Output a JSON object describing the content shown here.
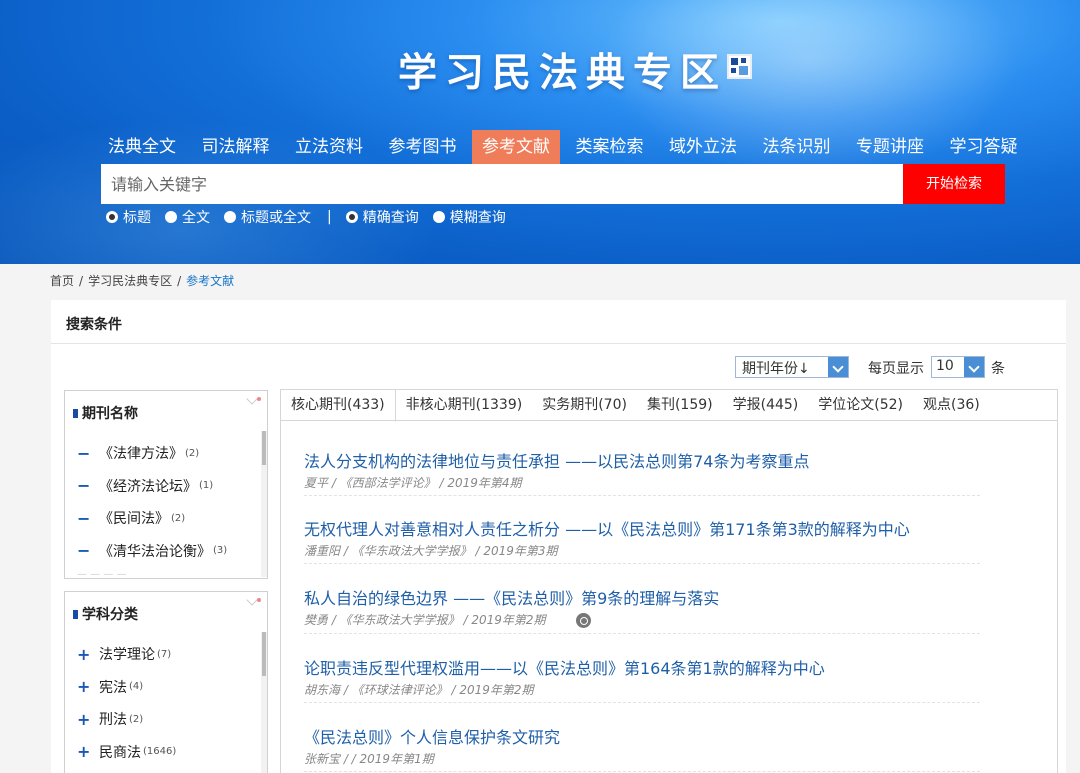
{
  "header": {
    "title": "学习民法典专区",
    "nav": [
      {
        "label": "法典全文",
        "active": false
      },
      {
        "label": "司法解释",
        "active": false
      },
      {
        "label": "立法资料",
        "active": false
      },
      {
        "label": "参考图书",
        "active": false
      },
      {
        "label": "参考文献",
        "active": true
      },
      {
        "label": "类案检索",
        "active": false
      },
      {
        "label": "域外立法",
        "active": false
      },
      {
        "label": "法条识别",
        "active": false
      },
      {
        "label": "专题讲座",
        "active": false
      },
      {
        "label": "学习答疑",
        "active": false
      }
    ],
    "search_placeholder": "请输入关键字",
    "search_button": "开始检索",
    "scope_options": [
      {
        "label": "标题",
        "selected": true
      },
      {
        "label": "全文",
        "selected": false
      },
      {
        "label": "标题或全文",
        "selected": false
      }
    ],
    "separator": "|",
    "match_options": [
      {
        "label": "精确查询",
        "selected": true
      },
      {
        "label": "模糊查询",
        "selected": false
      }
    ]
  },
  "breadcrumb": {
    "items": [
      "首页",
      "学习民法典专区",
      "参考文献"
    ],
    "separator": "/"
  },
  "filters": {
    "title": "搜索条件",
    "sort_select": "期刊年份↓",
    "per_page_label": "每页显示",
    "per_page_value": "10",
    "per_page_unit": "条"
  },
  "journal_panel": {
    "title": "期刊名称",
    "items": [
      {
        "label": "《法律方法》",
        "count": "(2)"
      },
      {
        "label": "《经济法论坛》",
        "count": "(1)"
      },
      {
        "label": "《民间法》",
        "count": "(2)"
      },
      {
        "label": "《清华法治论衡》",
        "count": "(3)"
      }
    ]
  },
  "subject_panel": {
    "title": "学科分类",
    "items": [
      {
        "label": "法学理论",
        "count": "(7)"
      },
      {
        "label": "宪法",
        "count": "(4)"
      },
      {
        "label": "刑法",
        "count": "(2)"
      },
      {
        "label": "民商法",
        "count": "(1646)"
      }
    ]
  },
  "tabs": [
    {
      "label": "核心期刊(433)",
      "active": true
    },
    {
      "label": "非核心期刊(1339)",
      "active": false
    },
    {
      "label": "实务期刊(70)",
      "active": false
    },
    {
      "label": "集刊(159)",
      "active": false
    },
    {
      "label": "学报(445)",
      "active": false
    },
    {
      "label": "学位论文(52)",
      "active": false
    },
    {
      "label": "观点(36)",
      "active": false
    }
  ],
  "articles": [
    {
      "title": "法人分支机构的法律地位与责任承担 ——以民法总则第74条为考察重点",
      "meta": "夏平 / 《西部法学评论》 / 2019年第4期"
    },
    {
      "title": "无权代理人对善意相对人责任之析分 ——以《民法总则》第171条第3款的解释为中心",
      "meta": "潘重阳 / 《华东政法大学学报》 / 2019年第3期"
    },
    {
      "title": "私人自治的绿色边界 ——《民法总则》第9条的理解与落实",
      "meta": "樊勇 / 《华东政法大学学报》 / 2019年第2期",
      "badge_icon": "share-icon"
    },
    {
      "title": "论职责违反型代理权滥用——以《民法总则》第164条第1款的解释为中心",
      "meta": "胡东海 / 《环球法律评论》 / 2019年第2期"
    },
    {
      "title": "《民法总则》个人信息保护条文研究",
      "meta": "张新宝 / / 2019年第1期"
    }
  ],
  "colors": {
    "banner_blue": "#136fd8",
    "active_nav": "#f07d5a",
    "search_button": "#ff0000",
    "link_blue": "#1f5fa8"
  }
}
